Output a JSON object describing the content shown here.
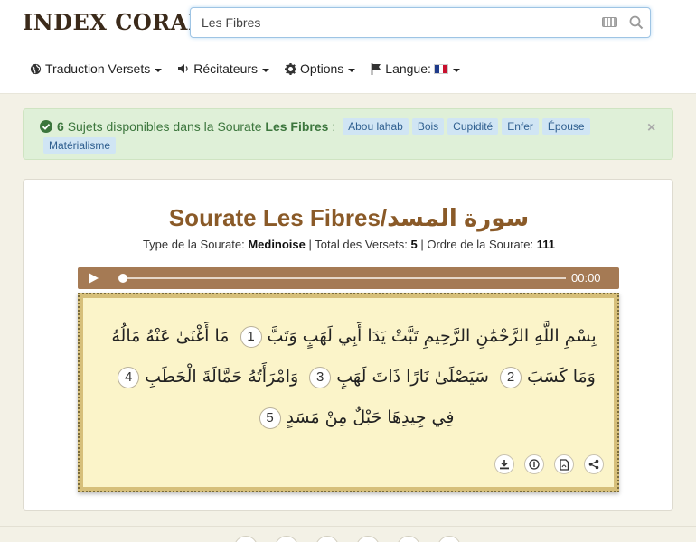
{
  "header": {
    "logo": "INDEX CORAN",
    "search": {
      "value": "Les Fibres",
      "placeholder": ""
    }
  },
  "nav": {
    "translation": "Traduction Versets",
    "reciters": "Récitateurs",
    "options": "Options",
    "language": "Langue:"
  },
  "alert": {
    "count": "6",
    "text": "Sujets disponibles dans la Sourate",
    "surah": "Les Fibres",
    "separator": ":",
    "tags": [
      "Abou lahab",
      "Bois",
      "Cupidité",
      "Enfer",
      "Épouse",
      "Matérialisme"
    ]
  },
  "surah": {
    "title": "Sourate Les Fibres/سورة المسد",
    "type_label": "Type de la Sourate:",
    "type_value": "Medinoise",
    "total_label": "| Total des Versets:",
    "total_value": "5",
    "order_label": "| Ordre de la Sourate:",
    "order_value": "111"
  },
  "player": {
    "time": "00:00",
    "progress": 0
  },
  "verses": {
    "basmala": "بِسْمِ اللَّهِ الرَّحْمَٰنِ الرَّحِيمِ",
    "v1": "تَبَّتْ يَدَا أَبِي لَهَبٍ وَتَبَّ",
    "v2": "مَا أَغْنَىٰ عَنْهُ مَالُهُ وَمَا كَسَبَ",
    "v3": "سَيَصْلَىٰ نَارًا ذَاتَ لَهَبٍ",
    "v4": "وَامْرَأَتُهُ حَمَّالَةَ الْحَطَبِ",
    "v5": "فِي جِيدِهَا حَبْلٌ مِنْ مَسَدٍ",
    "n1": "1",
    "n2": "2",
    "n3": "3",
    "n4": "4",
    "n5": "5"
  },
  "colors": {
    "accent": "#8a5a28",
    "alert_bg": "#dff0d8",
    "tag_bg": "#d0e5f4",
    "player": "#a57a54"
  }
}
